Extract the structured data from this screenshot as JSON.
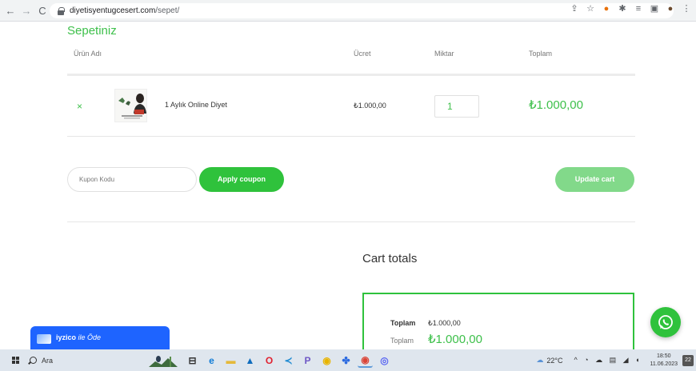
{
  "browser": {
    "url_domain": "diyetisyentugcesert.com",
    "url_path": "/sepet/"
  },
  "cart": {
    "title": "Sepetiniz",
    "columns": {
      "product": "Ürün Adı",
      "price": "Ücret",
      "quantity": "Miktar",
      "total": "Toplam"
    },
    "items": [
      {
        "name": "1 Aylık Online Diyet",
        "price": "₺1.000,00",
        "quantity": "1",
        "subtotal": "₺1.000,00"
      }
    ],
    "remove_glyph": "×",
    "coupon_placeholder": "Kupon Kodu",
    "apply_coupon_label": "Apply coupon",
    "update_cart_label": "Update cart"
  },
  "totals": {
    "title": "Cart totals",
    "rows": [
      {
        "label": "Toplam",
        "value": "₺1.000,00"
      },
      {
        "label": "Toplam",
        "value": "₺1.000,00"
      }
    ]
  },
  "iyzico": {
    "brand": "iyzico",
    "suffix": "ile Öde"
  },
  "taskbar": {
    "search_placeholder": "Ara",
    "weather": "22°C",
    "time": "18:50",
    "date": "11.06.2023",
    "notification_count": "22"
  },
  "colors": {
    "accent": "#3ec04b",
    "button_green": "#2fc23c",
    "button_green_disabled": "#82d98a",
    "iyzico_blue": "#1e64ff"
  }
}
